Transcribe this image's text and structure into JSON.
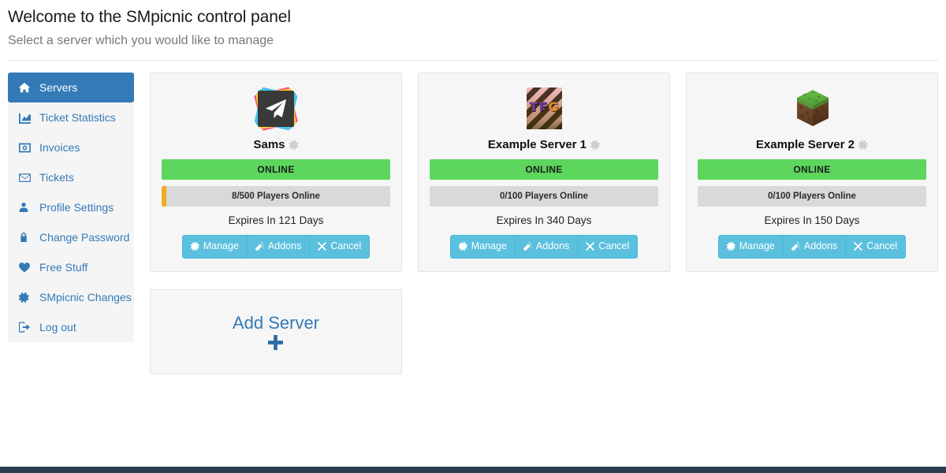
{
  "header": {
    "title": "Welcome to the SMpicnic control panel",
    "subtitle": "Select a server which you would like to manage"
  },
  "sidebar": {
    "items": [
      {
        "label": "Servers",
        "icon": "home-icon",
        "active": true
      },
      {
        "label": "Ticket Statistics",
        "icon": "chart-area-icon",
        "active": false
      },
      {
        "label": "Invoices",
        "icon": "money-icon",
        "active": false
      },
      {
        "label": "Tickets",
        "icon": "envelope-icon",
        "active": false
      },
      {
        "label": "Profile Settings",
        "icon": "user-icon",
        "active": false
      },
      {
        "label": "Change Password",
        "icon": "lock-icon",
        "active": false
      },
      {
        "label": "Free Stuff",
        "icon": "heart-icon",
        "active": false
      },
      {
        "label": "SMpicnic Changes",
        "icon": "gear-icon",
        "active": false
      },
      {
        "label": "Log out",
        "icon": "sign-out-icon",
        "active": false
      }
    ]
  },
  "servers": [
    {
      "name": "Sams",
      "icon": "paper-plane-rainbow-icon",
      "status": "ONLINE",
      "players_text": "8/500 Players Online",
      "players_online": 8,
      "players_max": 500,
      "players_percent": 1.6,
      "expires": "Expires In 121 Days",
      "buttons": [
        {
          "label": "Manage",
          "icon": "gear-icon"
        },
        {
          "label": "Addons",
          "icon": "magic-wand-icon"
        },
        {
          "label": "Cancel",
          "icon": "times-icon"
        }
      ]
    },
    {
      "name": "Example Server 1",
      "icon": "tfg-striped-icon",
      "status": "ONLINE",
      "players_text": "0/100 Players Online",
      "players_online": 0,
      "players_max": 100,
      "players_percent": 0,
      "expires": "Expires In 340 Days",
      "buttons": [
        {
          "label": "Manage",
          "icon": "gear-icon"
        },
        {
          "label": "Addons",
          "icon": "magic-wand-icon"
        },
        {
          "label": "Cancel",
          "icon": "times-icon"
        }
      ]
    },
    {
      "name": "Example Server 2",
      "icon": "minecraft-grass-block-icon",
      "status": "ONLINE",
      "players_text": "0/100 Players Online",
      "players_online": 0,
      "players_max": 100,
      "players_percent": 0,
      "expires": "Expires In 150 Days",
      "buttons": [
        {
          "label": "Manage",
          "icon": "gear-icon"
        },
        {
          "label": "Addons",
          "icon": "magic-wand-icon"
        },
        {
          "label": "Cancel",
          "icon": "times-icon"
        }
      ]
    }
  ],
  "add_server": {
    "label": "Add Server",
    "icon": "plus-icon"
  },
  "tfg_icon_letters": [
    "T",
    "F",
    "G"
  ],
  "colors": {
    "brand_blue": "#337ab7",
    "status_online_green": "#5cd65c",
    "button_info_blue": "#5bc0de",
    "players_fill_orange": "#f0ad24",
    "card_bg": "#f6f6f6",
    "sidebar_bg": "#f5f5f5",
    "footer_dark": "#2c3e50"
  }
}
